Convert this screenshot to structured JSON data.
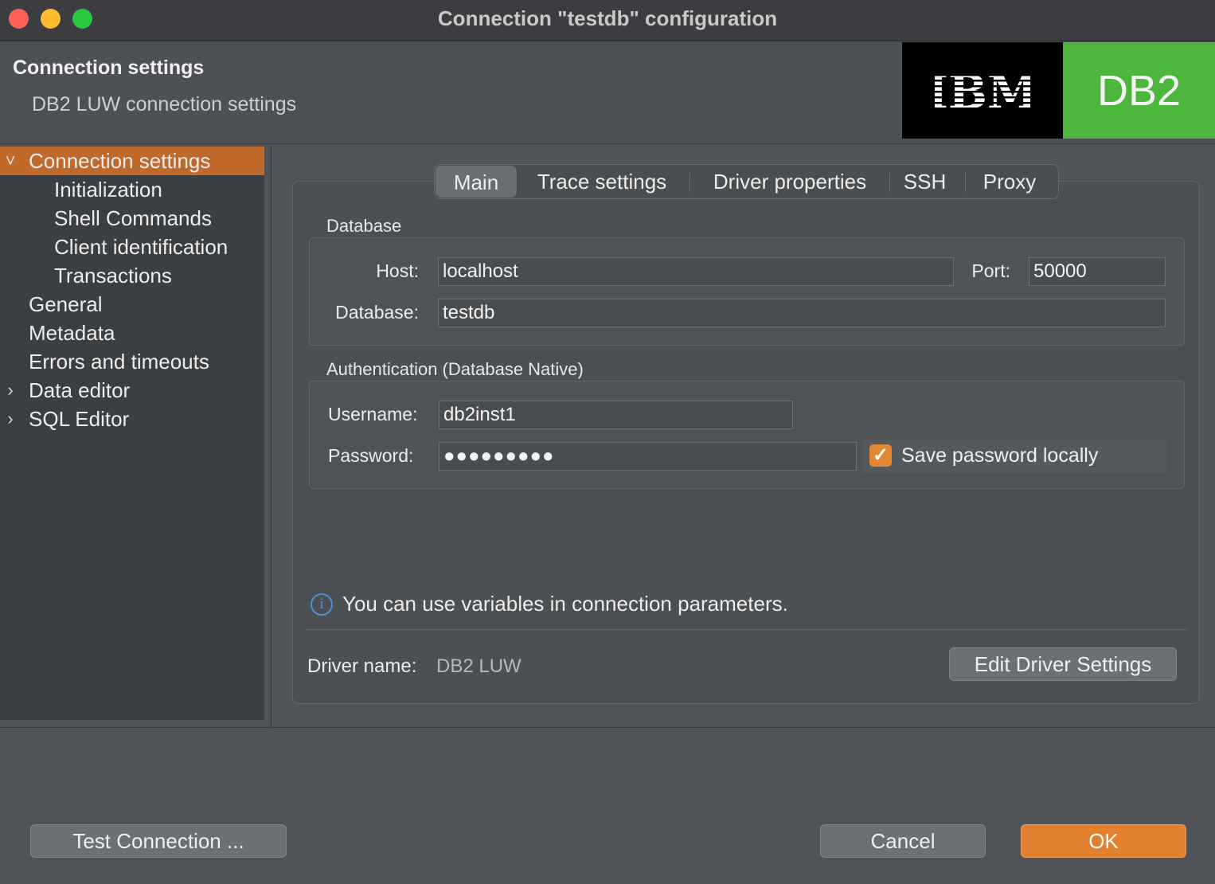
{
  "window": {
    "title": "Connection \"testdb\" configuration"
  },
  "header": {
    "title": "Connection settings",
    "subtitle": "DB2 LUW connection settings",
    "logo_left": "IBM",
    "logo_right": "DB2"
  },
  "sidebar": {
    "items": [
      {
        "label": "Connection settings",
        "chevron": "˅"
      },
      {
        "label": "Initialization"
      },
      {
        "label": "Shell Commands"
      },
      {
        "label": "Client identification"
      },
      {
        "label": "Transactions"
      },
      {
        "label": "General"
      },
      {
        "label": "Metadata"
      },
      {
        "label": "Errors and timeouts"
      },
      {
        "label": "Data editor",
        "chevron": "›"
      },
      {
        "label": "SQL Editor",
        "chevron": "›"
      }
    ]
  },
  "tabs": [
    "Main",
    "Trace settings",
    "Driver properties",
    "SSH",
    "Proxy"
  ],
  "database_group": {
    "label": "Database",
    "host_label": "Host:",
    "host_value": "localhost",
    "port_label": "Port:",
    "port_value": "50000",
    "database_label": "Database:",
    "database_value": "testdb"
  },
  "auth_group": {
    "label": "Authentication (Database Native)",
    "username_label": "Username:",
    "username_value": "db2inst1",
    "password_label": "Password:",
    "password_value": "●●●●●●●●●",
    "save_password_label": "Save password locally",
    "save_password_checked": true
  },
  "info": {
    "text": "You can use variables in connection parameters."
  },
  "driver": {
    "label": "Driver name:",
    "value": "DB2 LUW",
    "edit_button": "Edit Driver Settings"
  },
  "footer": {
    "test_button": "Test Connection ...",
    "cancel_button": "Cancel",
    "ok_button": "OK"
  },
  "colors": {
    "accent": "#e2802f",
    "selection": "#c1692a",
    "db2_green": "#4db63c"
  }
}
